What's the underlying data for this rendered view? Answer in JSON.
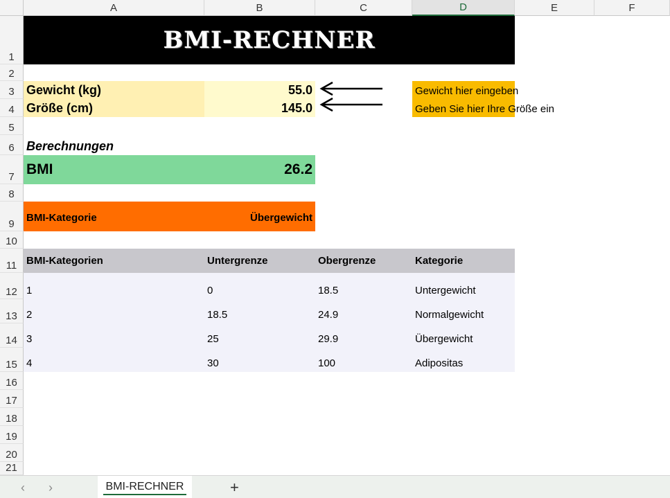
{
  "columns": [
    "A",
    "B",
    "C",
    "D",
    "E",
    "F"
  ],
  "rows": [
    "1",
    "2",
    "3",
    "4",
    "5",
    "6",
    "7",
    "8",
    "9",
    "10",
    "11",
    "12",
    "13",
    "14",
    "15",
    "16",
    "17",
    "18",
    "19",
    "20",
    "21"
  ],
  "title": "BMI-RECHNER",
  "inputs": {
    "weight_label": "Gewicht (kg)",
    "weight_value": "55.0",
    "height_label": "Größe (cm)",
    "height_value": "145.0"
  },
  "hints": {
    "weight": "Gewicht hier eingeben",
    "height": "Geben Sie hier Ihre Größe ein"
  },
  "section_heading": "Berechnungen",
  "bmi": {
    "label": "BMI",
    "value": "26.2"
  },
  "category": {
    "label": "BMI-Kategorie",
    "value": "Übergewicht"
  },
  "table": {
    "headers": [
      "BMI-Kategorien",
      "Untergrenze",
      "Obergrenze",
      "Kategorie"
    ],
    "rows": [
      [
        "1",
        "0",
        "18.5",
        "Untergewicht"
      ],
      [
        "2",
        "18.5",
        "24.9",
        "Normalgewicht"
      ],
      [
        "3",
        "25",
        "29.9",
        "Übergewicht"
      ],
      [
        "4",
        "30",
        "100",
        "Adipositas"
      ]
    ]
  },
  "sheet_tab": "BMI-RECHNER",
  "icons": {
    "prev": "chevron-left-icon",
    "next": "chevron-right-icon",
    "add": "plus-icon",
    "arrow": "arrow-left-icon"
  },
  "colors": {
    "title_bg": "#000000",
    "input_label": "#fff0b3",
    "input_value": "#fffacd",
    "hint": "#f9bb00",
    "bmi": "#7fd89a",
    "category": "#ff6d00",
    "table_header": "#c8c7cc",
    "table_body": "#f2f2fa",
    "selected_col": "#1e6b3a"
  }
}
